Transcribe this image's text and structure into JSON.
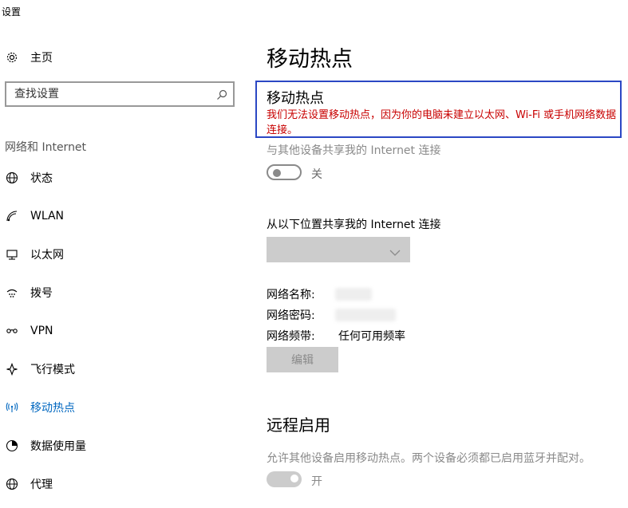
{
  "window": {
    "title": "设置"
  },
  "sidebar": {
    "home_label": "主页",
    "search_placeholder": "查找设置",
    "section_label": "网络和 Internet",
    "items": [
      {
        "label": "状态",
        "icon": "globe-icon"
      },
      {
        "label": "WLAN",
        "icon": "wifi-icon"
      },
      {
        "label": "以太网",
        "icon": "ethernet-icon"
      },
      {
        "label": "拨号",
        "icon": "dialup-icon"
      },
      {
        "label": "VPN",
        "icon": "vpn-icon"
      },
      {
        "label": "飞行模式",
        "icon": "airplane-icon"
      },
      {
        "label": "移动热点",
        "icon": "hotspot-icon",
        "active": true
      },
      {
        "label": "数据使用量",
        "icon": "data-usage-icon"
      },
      {
        "label": "代理",
        "icon": "globe-icon"
      }
    ]
  },
  "main": {
    "page_title": "移动热点",
    "error": {
      "title": "移动热点",
      "message": "我们无法设置移动热点，因为你的电脑未建立以太网、Wi-Fi 或手机网络数据连接。"
    },
    "share_label": "与其他设备共享我的 Internet 连接",
    "share_toggle": {
      "state": "关",
      "on": false
    },
    "share_from_label": "从以下位置共享我的 Internet 连接",
    "share_from_value": "",
    "network_name_label": "网络名称:",
    "network_password_label": "网络密码:",
    "network_band_label": "网络频带:",
    "network_band_value": "任何可用频率",
    "edit_button": "编辑",
    "remote": {
      "title": "远程启用",
      "description": "允许其他设备启用移动热点。两个设备必须都已启用蓝牙并配对。",
      "toggle": {
        "state": "开",
        "on": true
      }
    }
  },
  "colors": {
    "accent": "#0067c0",
    "error_text": "#c80000",
    "error_border": "#2b47c4",
    "disabled": "#8a8a8a"
  }
}
